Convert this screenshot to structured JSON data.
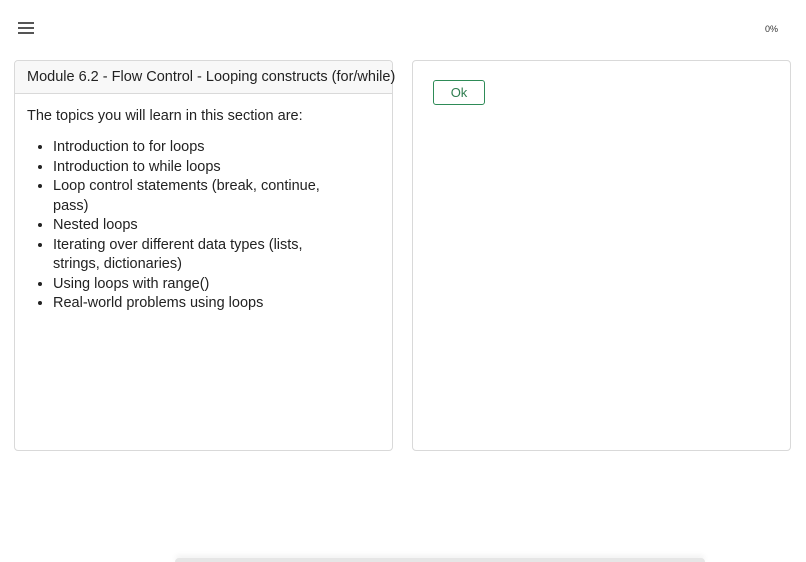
{
  "topbar": {
    "menu_icon": "hamburger-menu-icon",
    "progress": "0%"
  },
  "module_card": {
    "title": "Module 6.2 - Flow Control - Looping constructs (for/while)",
    "intro": "The topics you will learn in this section are:",
    "topics": [
      "Introduction to for loops",
      "Introduction to while loops",
      "Loop control statements (break, continue, pass)",
      "Nested loops",
      "Iterating over different data types (lists, strings, dictionaries)",
      "Using loops with range()",
      "Real-world problems using loops"
    ]
  },
  "action_card": {
    "ok_label": "Ok"
  },
  "colors": {
    "ok_border": "#2e8b57",
    "card_border": "#d9d9d9"
  }
}
